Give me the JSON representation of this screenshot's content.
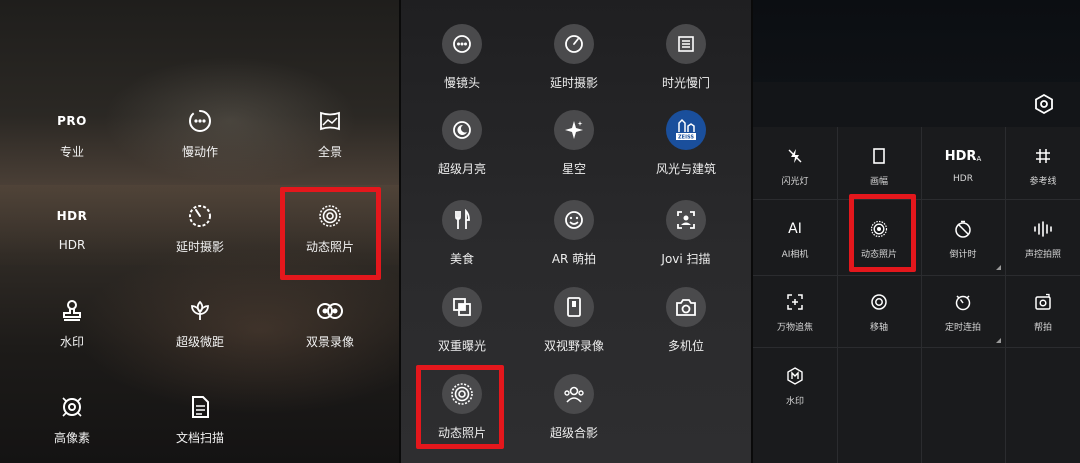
{
  "panel1": {
    "items": [
      {
        "icon": "pro-text",
        "text": "PRO",
        "label": "专业"
      },
      {
        "icon": "slow-motion-icon",
        "label": "慢动作"
      },
      {
        "icon": "panorama-icon",
        "label": "全景"
      },
      {
        "icon": "hdr-text",
        "text": "HDR",
        "label": "HDR"
      },
      {
        "icon": "timelapse-icon",
        "label": "延时摄影"
      },
      {
        "icon": "live-photo-icon",
        "label": "动态照片"
      },
      {
        "icon": "stamp-icon",
        "label": "水印"
      },
      {
        "icon": "flower-icon",
        "label": "超级微距"
      },
      {
        "icon": "dual-view-icon",
        "label": "双景录像"
      },
      {
        "icon": "hi-res-icon",
        "label": "高像素"
      },
      {
        "icon": "document-icon",
        "label": "文档扫描"
      }
    ]
  },
  "panel2": {
    "items": [
      {
        "icon": "slow-lens-icon",
        "label": "慢镜头"
      },
      {
        "icon": "timelapse-icon",
        "label": "延时摄影"
      },
      {
        "icon": "time-shutter-icon",
        "label": "时光慢门"
      },
      {
        "icon": "moon-icon",
        "label": "超级月亮"
      },
      {
        "icon": "sparkle-icon",
        "label": "星空"
      },
      {
        "icon": "zeiss-icon",
        "text": "ZEISS",
        "label": "风光与建筑"
      },
      {
        "icon": "fork-knife-icon",
        "label": "美食"
      },
      {
        "icon": "smile-icon",
        "label": "AR 萌拍"
      },
      {
        "icon": "scan-icon",
        "label": "Jovi 扫描"
      },
      {
        "icon": "double-exposure-icon",
        "label": "双重曝光"
      },
      {
        "icon": "dual-view-icon",
        "label": "双视野录像"
      },
      {
        "icon": "multi-camera-icon",
        "label": "多机位"
      },
      {
        "icon": "live-photo-icon",
        "label": "动态照片"
      },
      {
        "icon": "group-photo-icon",
        "label": "超级合影"
      }
    ]
  },
  "panel3": {
    "items": [
      {
        "icon": "flash-off-icon",
        "label": "闪光灯"
      },
      {
        "icon": "aspect-ratio-icon",
        "label": "画幅"
      },
      {
        "icon": "hdr-text",
        "text": "HDR",
        "sub": "A",
        "label": "HDR"
      },
      {
        "icon": "grid-icon",
        "label": "参考线"
      },
      {
        "icon": "ai-text",
        "text": "AI",
        "label": "AI相机"
      },
      {
        "icon": "live-photo-icon",
        "label": "动态照片"
      },
      {
        "icon": "self-timer-icon",
        "label": "倒计时"
      },
      {
        "icon": "voice-icon",
        "label": "声控拍照"
      },
      {
        "icon": "focus-track-icon",
        "label": "万物追焦"
      },
      {
        "icon": "tilt-shift-icon",
        "label": "移轴"
      },
      {
        "icon": "interval-icon",
        "label": "定时连拍"
      },
      {
        "icon": "help-icon",
        "label": "帮拍"
      },
      {
        "icon": "watermark-icon",
        "label": "水印"
      }
    ]
  },
  "colors": {
    "highlight": "#e4171c",
    "zeiss": "#1a4f9c"
  }
}
